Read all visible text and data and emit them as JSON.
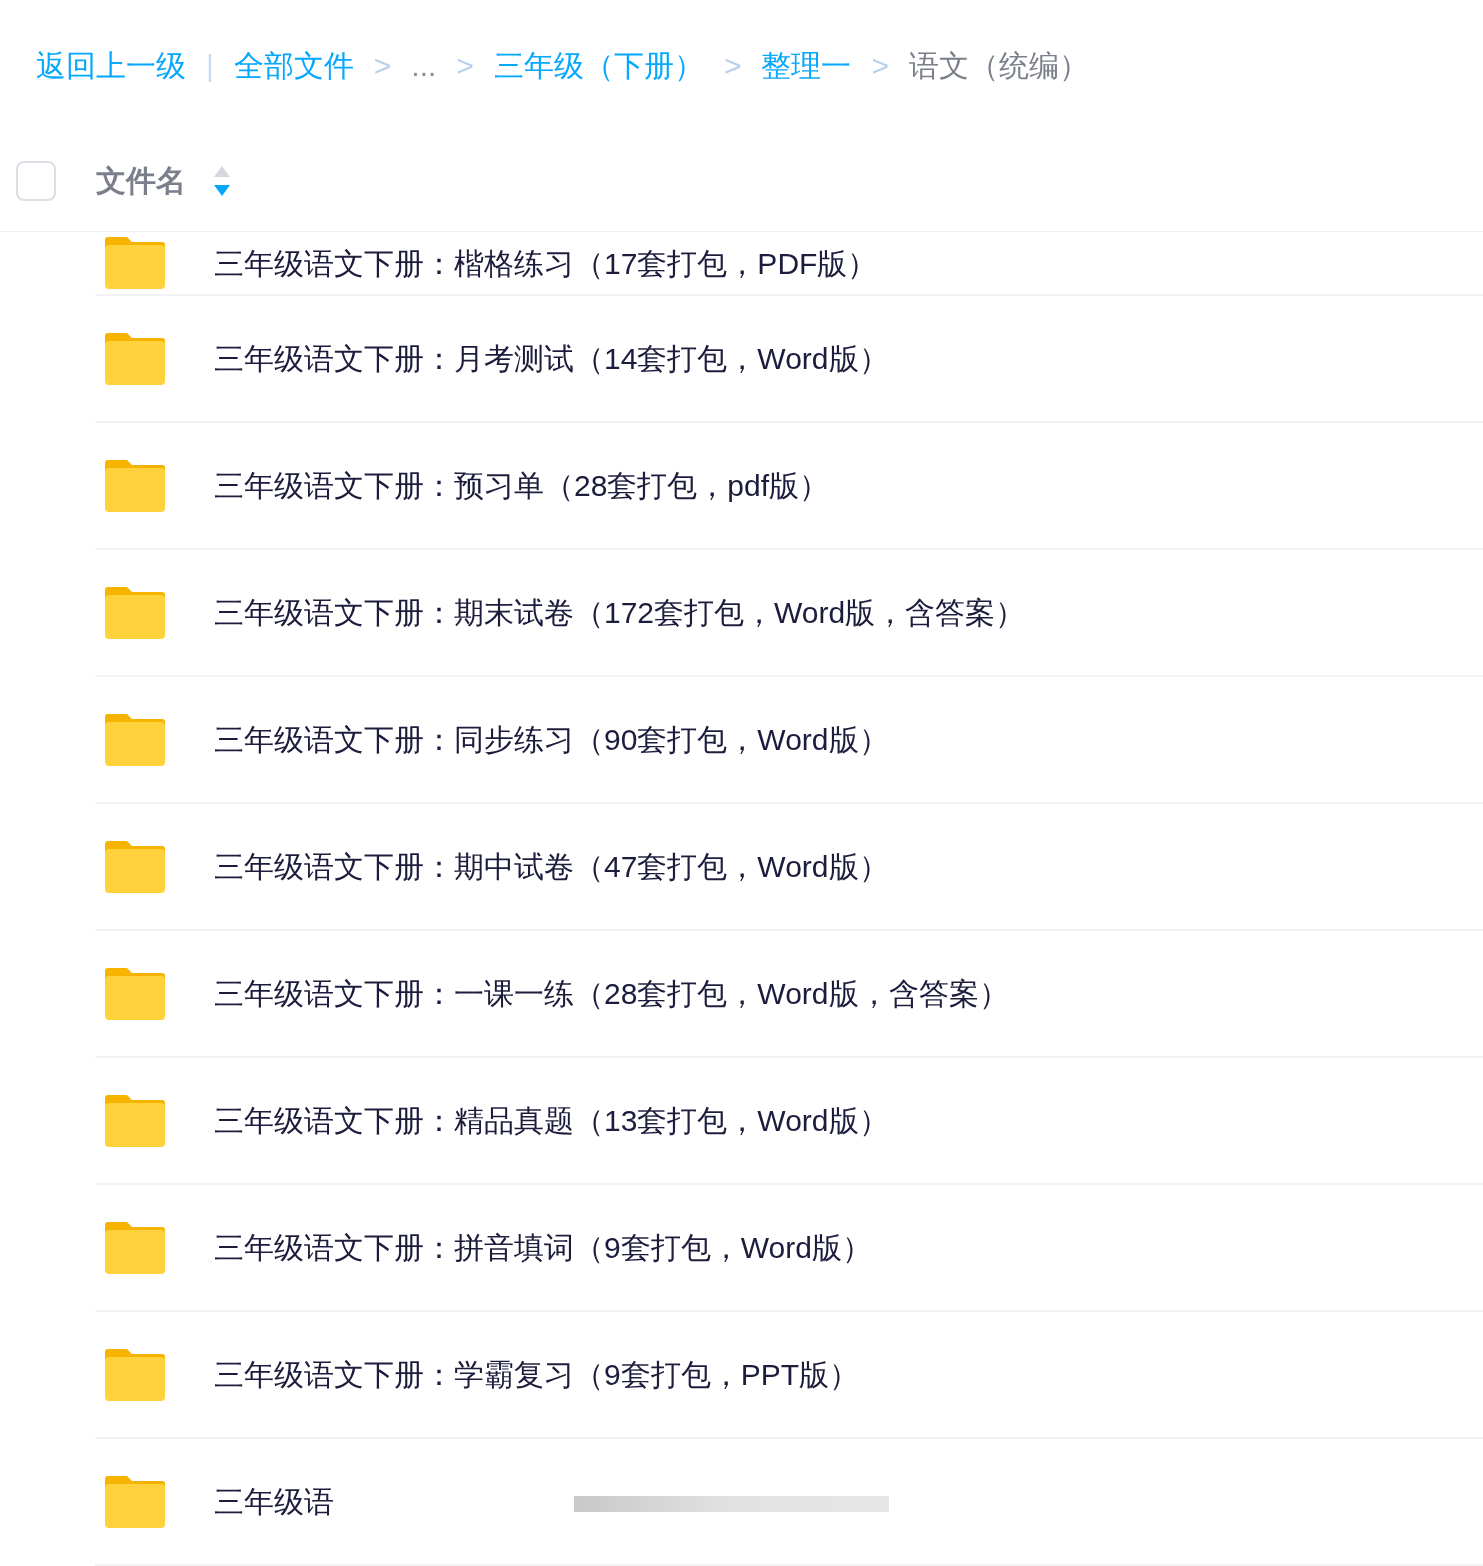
{
  "breadcrumb": [
    {
      "kind": "link",
      "text": "返回上一级"
    },
    {
      "kind": "divider",
      "text": "|"
    },
    {
      "kind": "link",
      "text": "全部文件"
    },
    {
      "kind": "separator",
      "text": ">"
    },
    {
      "kind": "ellipsis",
      "text": "..."
    },
    {
      "kind": "separator",
      "text": ">"
    },
    {
      "kind": "link",
      "text": "三年级（下册）"
    },
    {
      "kind": "separator",
      "text": ">"
    },
    {
      "kind": "link",
      "text": "整理一"
    },
    {
      "kind": "separator",
      "text": ">"
    },
    {
      "kind": "current",
      "text": "语文（统编）"
    }
  ],
  "header": {
    "checked": false,
    "column": "文件名",
    "sorted_descending": true
  },
  "files": [
    {
      "name": "三年级语文下册：楷格练习（17套打包，PDF版）",
      "redacted": false
    },
    {
      "name": "三年级语文下册：月考测试（14套打包，Word版）",
      "redacted": false
    },
    {
      "name": "三年级语文下册：预习单（28套打包，pdf版）",
      "redacted": false
    },
    {
      "name": "三年级语文下册：期末试卷（172套打包，Word版，含答案）",
      "redacted": false
    },
    {
      "name": "三年级语文下册：同步练习（90套打包，Word版）",
      "redacted": false
    },
    {
      "name": "三年级语文下册：期中试卷（47套打包，Word版）",
      "redacted": false
    },
    {
      "name": "三年级语文下册：一课一练（28套打包，Word版，含答案）",
      "redacted": false
    },
    {
      "name": "三年级语文下册：精品真题（13套打包，Word版）",
      "redacted": false
    },
    {
      "name": "三年级语文下册：拼音填词（9套打包，Word版）",
      "redacted": false
    },
    {
      "name": "三年级语文下册：学霸复习（9套打包，PPT版）",
      "redacted": false
    },
    {
      "name": "三年级语",
      "redacted": true
    }
  ]
}
